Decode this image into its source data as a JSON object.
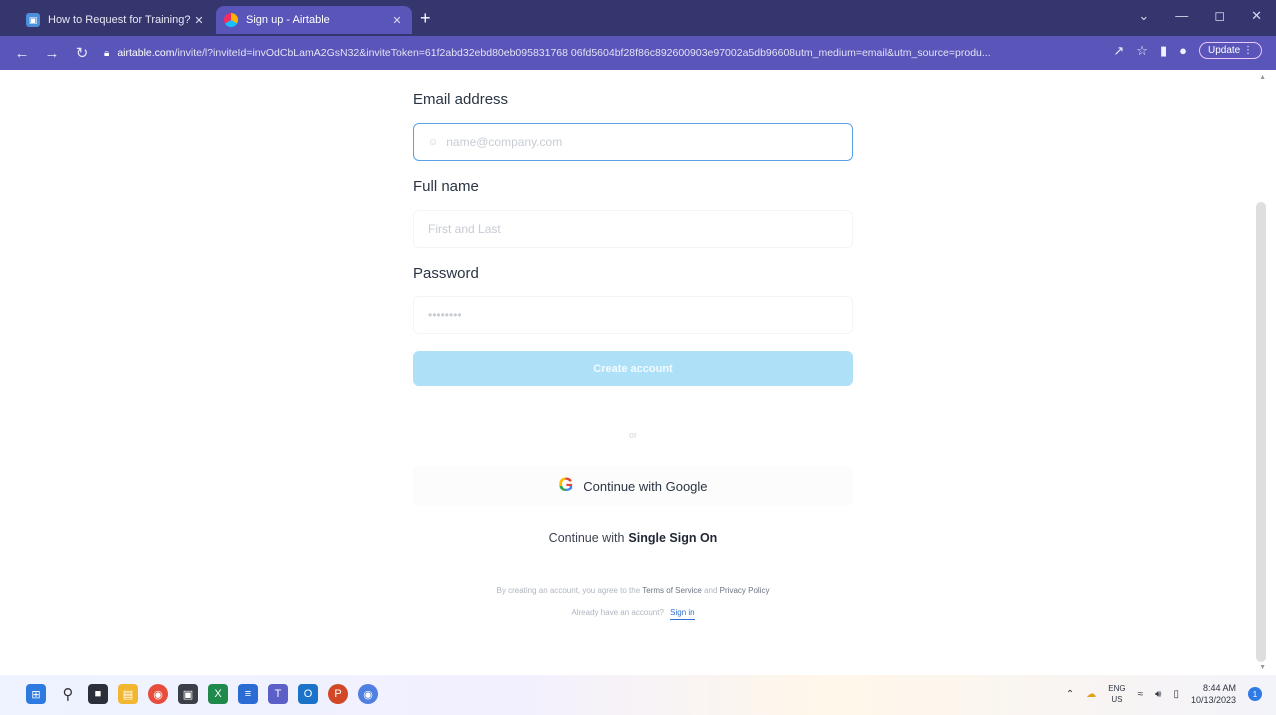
{
  "browser": {
    "tabs": [
      {
        "title": "How to Request for Training? |",
        "active": false
      },
      {
        "title": "Sign up - Airtable",
        "active": true
      }
    ],
    "url_host": "airtable.com",
    "url_path": "/invite/l?inviteId=invOdCbLamA2GsN32&inviteToken=61f2abd32ebd80eb095831768 06fd5604bf28f86c892600903e97002a5db96608utm_medium=email&utm_source=produ...",
    "update_label": "Update"
  },
  "form": {
    "email_label": "Email address",
    "email_placeholder": "name@company.com",
    "name_label": "Full name",
    "name_placeholder": "First and Last",
    "password_label": "Password",
    "password_placeholder": "••••••••",
    "create_button": "Create account",
    "or_text": "or",
    "google_button": "Continue with Google",
    "sso_prefix": "Continue with",
    "sso_strong": "Single Sign On",
    "legal_prefix": "By creating an account, you agree to the",
    "terms_link": "Terms of Service",
    "legal_and": "and",
    "privacy_link": "Privacy Policy",
    "have_account": "Already have an account?",
    "signin_link": "Sign in"
  },
  "taskbar": {
    "lang_top": "ENG",
    "lang_bottom": "US",
    "time": "8:44 AM",
    "date": "10/13/2023",
    "notification_count": "1"
  },
  "colors": {
    "tabstrip": "#35366e",
    "toolbar": "#5a55b8",
    "create_button": "#aee0f8",
    "email_border": "#5aa0e6",
    "link": "#2d72d2"
  }
}
